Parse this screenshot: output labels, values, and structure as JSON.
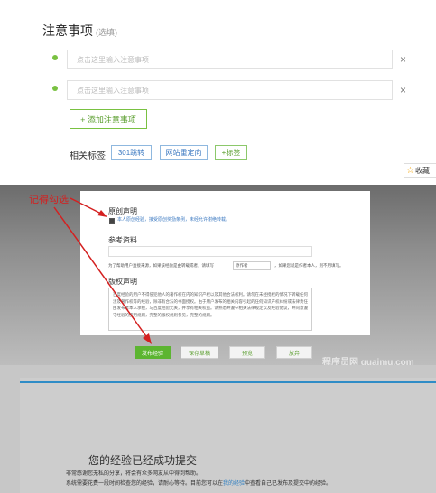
{
  "notice": {
    "title": "注意事项",
    "optional": "(选填)",
    "placeholder": "点击这里输入注意事项",
    "remove": "×",
    "add_label": "+ 添加注意事项"
  },
  "tags": {
    "label": "相关标签",
    "items": [
      "301跳转",
      "网站重定向",
      "+标签"
    ]
  },
  "favorite": {
    "label": "收藏"
  },
  "annotation": "记得勾选",
  "original": {
    "title": "原创声明",
    "checkbox_text": "本人原创经验，接受原创奖励条例，未经允许谢绝转载。"
  },
  "reference": {
    "title": "参考资料",
    "note": "为了帮助用户直接来源，如果该经验是由转载或者，请填写",
    "select": "原作者",
    "note2": "，如果您就是作者本人，则不用填写。"
  },
  "copyright": {
    "title": "版权声明",
    "text": "百度经验的用户不得侵犯他人的著作权在内的知识产权以及其他合法权利。请勿在未经授权的情况下转载任何涉及著作权等的经验，除非有合法的书面授权。由于用户发布的相关内容引起的任何知识产权纠纷或法律责任由发布者本人承担，与百度经验无关，并享有相关权益。请熟悉并遵守相关法律规定以及经验协议，并同意遵守经验的使用规则，完整的版权规则参见，完整的规则。"
  },
  "buttons": {
    "publish": "发布经验",
    "save": "保存草稿",
    "preview": "预览",
    "cancel": "放弃"
  },
  "watermark": "程序员网 guaimu.com",
  "success": {
    "title": "您的经验已经成功提交",
    "line1": "非常感谢您无私的分享，将会有众多网友从中得到帮助。",
    "line2_a": "系统需要花费一段时间检查您的经验，请耐心等待。目前您可以在",
    "line2_link": "我的经验",
    "line2_b": "中查看自己已发布及提交中的经验。"
  },
  "colors": {
    "accent_green": "#79c141",
    "link_blue": "#3d7ac1",
    "annotation_red": "#d42020"
  }
}
